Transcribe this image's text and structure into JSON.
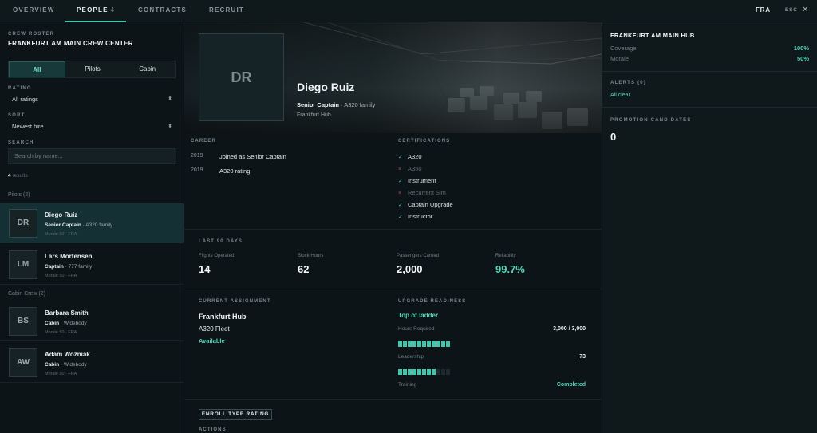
{
  "nav": {
    "tabs": [
      {
        "label": "OVERVIEW"
      },
      {
        "label": "PEOPLE",
        "count": "4"
      },
      {
        "label": "CONTRACTS"
      },
      {
        "label": "RECRUIT"
      }
    ],
    "region": "FRA",
    "esc": "ESC",
    "close_icon": "close-icon"
  },
  "sidebar": {
    "roster_label": "CREW ROSTER",
    "roster_title": "FRANKFURT AM MAIN CREW CENTER",
    "segments": [
      "All",
      "Pilots",
      "Cabin"
    ],
    "rating_label": "RATING",
    "rating_value": "All ratings",
    "sort_label": "SORT",
    "sort_value": "Newest hire",
    "search_label": "SEARCH",
    "search_placeholder": "Search by name...",
    "results_count": "4",
    "results_word": "results",
    "groups": [
      {
        "label": "Pilots (2)",
        "people": [
          {
            "initials": "DR",
            "name": "Diego Ruiz",
            "role": "Senior Captain",
            "type": "· A320 family",
            "meta": "Morale 50 · FRA"
          },
          {
            "initials": "LM",
            "name": "Lars Mortensen",
            "role": "Captain",
            "type": "· 777 family",
            "meta": "Morale 50 · FRA"
          }
        ]
      },
      {
        "label": "Cabin Crew (2)",
        "people": [
          {
            "initials": "BS",
            "name": "Barbara Smith",
            "role": "Cabin",
            "type": "· Widebody",
            "meta": "Morale 50 · FRA"
          },
          {
            "initials": "AW",
            "name": "Adam Woźniak",
            "role": "Cabin",
            "type": "· Widebody",
            "meta": "Morale 50 · FRA"
          }
        ]
      }
    ]
  },
  "profile": {
    "initials": "DR",
    "name": "Diego Ruiz",
    "role": "Senior Captain",
    "type": "· A320 family",
    "base": "Frankfurt Hub",
    "career_label": "CAREER",
    "career": [
      {
        "year": "2019",
        "text": "Joined as Senior Captain"
      },
      {
        "year": "2019",
        "text": "A320 rating"
      }
    ],
    "certifications_label": "CERTIFICATIONS",
    "certifications": [
      {
        "name": "A320",
        "ok": true,
        "mark": "✓"
      },
      {
        "name": "A350",
        "ok": false,
        "mark": "×"
      },
      {
        "name": "Instrument",
        "ok": true,
        "mark": "✓"
      },
      {
        "name": "Recurrent Sim",
        "ok": false,
        "mark": "×"
      },
      {
        "name": "Captain Upgrade",
        "ok": true,
        "mark": "✓"
      },
      {
        "name": "Instructor",
        "ok": true,
        "mark": "✓"
      }
    ],
    "stats_label": "LAST 90 DAYS",
    "stats": [
      {
        "label": "Flights Operated",
        "value": "14"
      },
      {
        "label": "Block Hours",
        "value": "62"
      },
      {
        "label": "Passengers Carried",
        "value": "2,000"
      },
      {
        "label": "Reliability",
        "value": "99.7%"
      }
    ],
    "assignment_label": "CURRENT ASSIGNMENT",
    "assignment": {
      "hub": "Frankfurt Hub",
      "fleet": "A320 Fleet",
      "status": "Available"
    },
    "upgrade_label": "UPGRADE READINESS",
    "upgrade_title": "Top of ladder",
    "upgrade_rows": [
      {
        "label": "Hours Required",
        "value": "3,000 / 3,000",
        "fill": 1.0
      },
      {
        "label": "Leadership",
        "value": "73",
        "fill": 0.73
      },
      {
        "label": "Training",
        "value": "Completed"
      }
    ],
    "enroll_button": "ENROLL TYPE RATING",
    "actions_label": "ACTIONS"
  },
  "right": {
    "hub_title": "FRANKFURT AM MAIN HUB",
    "coverage_label": "Coverage",
    "coverage_value": "100%",
    "morale_label": "Morale",
    "morale_value": "50%",
    "alerts_label": "ALERTS (0)",
    "alerts_status": "All clear",
    "promotion_label": "PROMOTION CANDIDATES",
    "promotion_count": "0"
  },
  "colors": {
    "accent": "#43c6ac",
    "background": "#0c1417",
    "error": "#c0504d"
  }
}
